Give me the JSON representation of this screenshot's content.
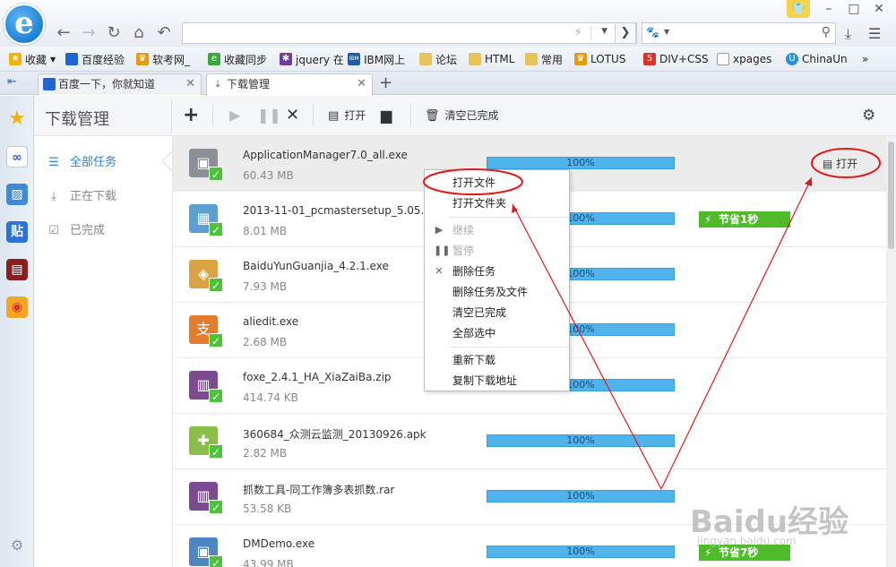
{
  "browser": {
    "address_value": "",
    "search_value": "",
    "favorites": [
      {
        "label": "收藏",
        "icon": "star-icon",
        "color": "#f0b400"
      },
      {
        "label": "百度经验",
        "icon": "baidu-paw-icon",
        "color": "#2460d8"
      },
      {
        "label": "软考网_",
        "icon": "trophy-icon",
        "color": "#e39b12"
      },
      {
        "label": "收藏同步",
        "icon": "ie-icon",
        "color": "#3ea63e"
      },
      {
        "label": "jquery 在",
        "icon": "jquery-icon",
        "color": "#6b3fa0"
      },
      {
        "label": "IBM网上",
        "icon": "ibm-icon",
        "color": "#1f5fa8"
      },
      {
        "label": "论坛",
        "icon": "folder-icon",
        "color": "#e8c25a"
      },
      {
        "label": "HTML",
        "icon": "folder-icon",
        "color": "#e8c25a"
      },
      {
        "label": "常用",
        "icon": "folder-icon",
        "color": "#e8c25a"
      },
      {
        "label": "LOTUS",
        "icon": "trophy-icon",
        "color": "#e39b12"
      },
      {
        "label": "DIV+CSS",
        "icon": "five-icon",
        "color": "#d9342b"
      },
      {
        "label": "xpages",
        "icon": "page-icon",
        "color": "#999999"
      },
      {
        "label": "ChinaUn",
        "icon": "globe-icon",
        "color": "#2f8fd8"
      }
    ],
    "overflow": "»",
    "tabs": [
      {
        "label": "百度一下，你就知道",
        "icon": "baidu-paw-icon",
        "active": false
      },
      {
        "label": "下载管理",
        "icon": "download-icon",
        "active": true
      }
    ],
    "new_tab": "+"
  },
  "download_manager": {
    "title": "下载管理",
    "toolbar": {
      "open_label": "打开",
      "clear_completed_label": "清空已完成"
    },
    "nav": [
      {
        "label": "全部任务",
        "icon": "list-icon",
        "active": true
      },
      {
        "label": "正在下载",
        "icon": "download-icon",
        "active": false
      },
      {
        "label": "已完成",
        "icon": "checkbox-icon",
        "active": false
      }
    ],
    "downloads": [
      {
        "name": "ApplicationManager7.0_all.exe",
        "size": "60.43 MB",
        "progress": "100%",
        "saved": "",
        "action": "打开",
        "selected": true,
        "icon_color": "#8b8f96"
      },
      {
        "name": "2013-11-01_pcmastersetup_5.05.exe",
        "size": "8.01 MB",
        "progress": "100%",
        "saved": "节省1秒",
        "action": "",
        "selected": false,
        "icon_color": "#5e9fd2"
      },
      {
        "name": "BaiduYunGuanjia_4.2.1.exe",
        "size": "7.93 MB",
        "progress": "100%",
        "saved": "",
        "action": "",
        "selected": false,
        "icon_color": "#d9a441"
      },
      {
        "name": "aliedit.exe",
        "size": "2.68 MB",
        "progress": "100%",
        "saved": "",
        "action": "",
        "selected": false,
        "icon_color": "#e37c2c"
      },
      {
        "name": "foxe_2.4.1_HA_XiaZaiBa.zip",
        "size": "414.74 KB",
        "progress": "100%",
        "saved": "",
        "action": "",
        "selected": false,
        "icon_color": "#7b4a8f"
      },
      {
        "name": "360684_众测云监测_20130926.apk",
        "size": "2.82 MB",
        "progress": "100%",
        "saved": "",
        "action": "",
        "selected": false,
        "icon_color": "#8bbd4a"
      },
      {
        "name": "抓数工具-同工作簿多表抓数.rar",
        "size": "53.58 KB",
        "progress": "100%",
        "saved": "",
        "action": "",
        "selected": false,
        "icon_color": "#7b4a8f"
      },
      {
        "name": "DMDemo.exe",
        "size": "43.99 MB",
        "progress": "100%",
        "saved": "节省7秒",
        "action": "",
        "selected": false,
        "icon_color": "#4e86c4"
      }
    ],
    "context_menu": [
      {
        "label": "打开文件",
        "icon": "",
        "disabled": false
      },
      {
        "label": "打开文件夹",
        "icon": "",
        "disabled": false
      },
      {
        "label": "继续",
        "icon": "play-icon",
        "disabled": true
      },
      {
        "label": "暂停",
        "icon": "pause-icon",
        "disabled": true
      },
      {
        "label": "删除任务",
        "icon": "close-icon",
        "disabled": false
      },
      {
        "label": "删除任务及文件",
        "icon": "",
        "disabled": false
      },
      {
        "label": "清空已完成",
        "icon": "",
        "disabled": false
      },
      {
        "label": "全部选中",
        "icon": "",
        "disabled": false
      },
      {
        "label": "重新下载",
        "icon": "",
        "disabled": false
      },
      {
        "label": "复制下载地址",
        "icon": "",
        "disabled": false
      }
    ]
  },
  "annotation_color": "#e01a1a",
  "watermark": {
    "text": "Baidu经验",
    "sub": "jingyan.baidu.com"
  }
}
